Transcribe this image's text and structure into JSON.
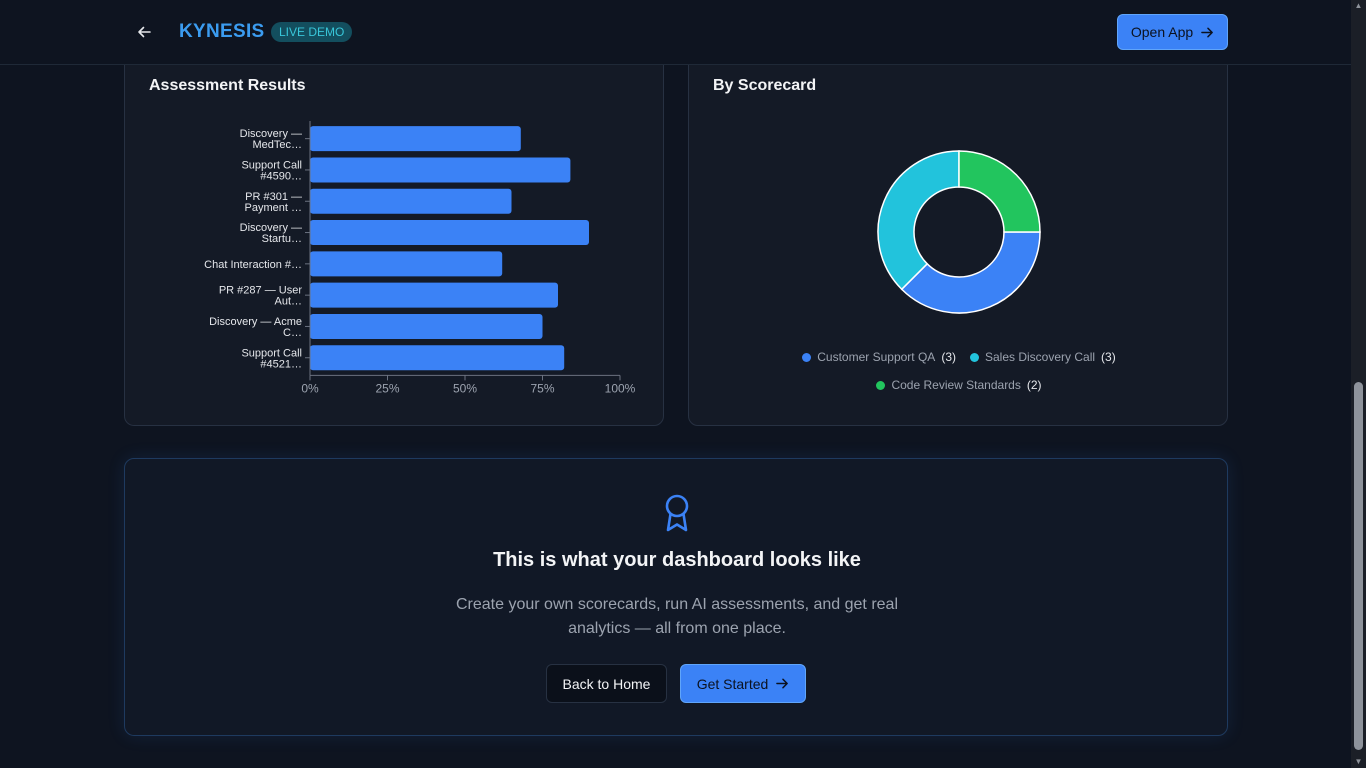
{
  "header": {
    "brand": "KYNESIS",
    "badge": "LIVE DEMO",
    "open_app_label": "Open App"
  },
  "results": {
    "title": "Assessment Results"
  },
  "scorecard": {
    "title": "By Scorecard"
  },
  "chart_data": [
    {
      "type": "bar",
      "orientation": "horizontal",
      "categories": [
        [
          "Discovery —",
          "MedTec…"
        ],
        [
          "Support Call",
          "#4590…"
        ],
        [
          "PR #301 —",
          "Payment …"
        ],
        [
          "Discovery —",
          "Startu…"
        ],
        [
          "Chat Interaction #…"
        ],
        [
          "PR #287 — User",
          "Aut…"
        ],
        [
          "Discovery — Acme",
          "C…"
        ],
        [
          "Support Call",
          "#4521…"
        ]
      ],
      "values": [
        68,
        84,
        65,
        90,
        62,
        80,
        75,
        82
      ],
      "xlim": [
        0,
        100
      ],
      "xticks": [
        "0%",
        "25%",
        "50%",
        "75%",
        "100%"
      ],
      "title": "Assessment Results",
      "colors": [
        "#3b82f6"
      ]
    },
    {
      "type": "pie",
      "donut": true,
      "title": "By Scorecard",
      "slices": [
        {
          "label": "Customer Support QA",
          "value": 3,
          "color": "#3b82f6"
        },
        {
          "label": "Sales Discovery Call",
          "value": 3,
          "color": "#22c3dc"
        },
        {
          "label": "Code Review Standards",
          "value": 2,
          "color": "#22c55e"
        }
      ]
    }
  ],
  "cta": {
    "title": "This is what your dashboard looks like",
    "description": "Create your own scorecards, run AI assessments, and get real analytics — all from one place.",
    "back_label": "Back to Home",
    "start_label": "Get Started"
  },
  "colors": {
    "accent": "#3b82f6",
    "brand": "#3b9cf0",
    "badge_bg": "#134e5e",
    "badge_text": "#38c6d9"
  }
}
